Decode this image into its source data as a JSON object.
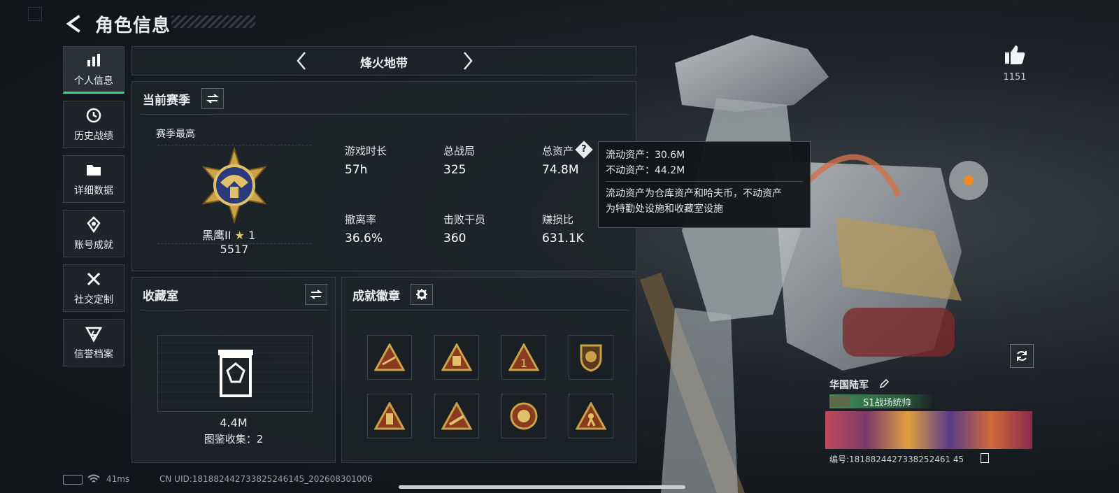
{
  "header": {
    "title": "角色信息"
  },
  "sidebar": {
    "items": [
      {
        "label": "个人信息",
        "icon": "bar-chart-icon"
      },
      {
        "label": "历史战绩",
        "icon": "clock-icon"
      },
      {
        "label": "详细数据",
        "icon": "folder-icon"
      },
      {
        "label": "账号成就",
        "icon": "achievement-icon"
      },
      {
        "label": "社交定制",
        "icon": "tools-icon"
      },
      {
        "label": "信誉档案",
        "icon": "credit-icon"
      }
    ]
  },
  "mode_selector": {
    "label": "烽火地带"
  },
  "season": {
    "title": "当前赛季",
    "peak_label": "赛季最高",
    "rank_name": "黑鹰II",
    "rank_stars": "1",
    "rank_score": "5517",
    "stats": [
      {
        "label": "游戏时长",
        "value": "57h"
      },
      {
        "label": "总战局",
        "value": "325"
      },
      {
        "label": "总资产",
        "value": "74.8M"
      },
      {
        "label": "撤离率",
        "value": "36.6%"
      },
      {
        "label": "击败干员",
        "value": "360"
      },
      {
        "label": "赚损比",
        "value": "631.1K"
      }
    ]
  },
  "tooltip": {
    "line1": "流动资产：30.6M",
    "line2": "不动资产：44.2M",
    "desc1": "流动资产为仓库资产和哈夫币，不动资产",
    "desc2": "为特勤处设施和收藏室设施"
  },
  "collection": {
    "title": "收藏室",
    "value": "4.4M",
    "catalog": "图鉴收集：2"
  },
  "achievements": {
    "title": "成就徽章"
  },
  "likes": {
    "count": "1151"
  },
  "profile": {
    "name": "华国陆军",
    "title_badge": "S1战场统帅",
    "id_line": "编号:1818824427338252461 45"
  },
  "status_bar": {
    "ping": "41ms",
    "uid": "CN UID:181882442733825246145_202608301006"
  },
  "colors": {
    "accent_green": "#3ad27a",
    "gold": "#c9a24a",
    "badge_green": "#3f8f5a"
  }
}
